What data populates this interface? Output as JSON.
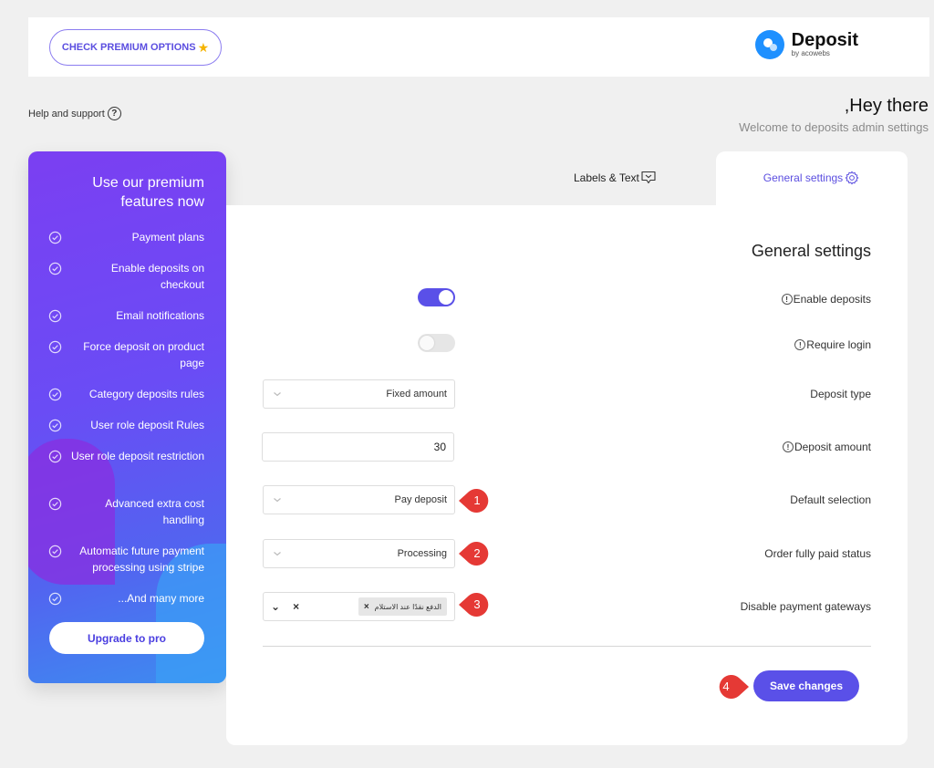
{
  "topbar": {
    "premium_label": "CHECK PREMIUM OPTIONS",
    "brand_name": "Deposit",
    "brand_sub": "by acowebs"
  },
  "help": {
    "label": "Help and support",
    "icon_glyph": "?"
  },
  "greeting": {
    "title": ",Hey there",
    "subtitle": "Welcome to deposits admin settings"
  },
  "promo": {
    "title": "Use our premium features now",
    "features": [
      "Payment plans",
      "Enable deposits on checkout",
      "Email notifications",
      "Force deposit on product page",
      "Category deposits rules",
      "User role deposit Rules",
      "User role deposit restriction",
      "Advanced extra cost handling",
      "Automatic future payment processing using stripe",
      "...And many more"
    ],
    "upgrade_label": "Upgrade to pro"
  },
  "tabs": {
    "labels_text": "Labels & Text",
    "general": "General settings"
  },
  "panel": {
    "title": "General settings",
    "info_glyph": "!",
    "enable_deposits": {
      "label": "Enable deposits",
      "enabled": true
    },
    "require_login": {
      "label": "Require login",
      "enabled": false
    },
    "deposit_type": {
      "label": "Deposit type",
      "value": "Fixed amount"
    },
    "deposit_amount": {
      "label": "Deposit amount",
      "value": "30"
    },
    "default_selection": {
      "label": "Default selection",
      "value": "Pay deposit"
    },
    "order_status": {
      "label": "Order fully paid status",
      "value": "Processing"
    },
    "disable_gateways": {
      "label": "Disable payment gateways",
      "ctrl_expand": "⌄",
      "ctrl_clear": "×",
      "tags": [
        "الدفع نقدًا عند الاستلام"
      ]
    },
    "save_label": "Save changes"
  },
  "badges": [
    "1",
    "2",
    "3",
    "4"
  ],
  "colors": {
    "accent": "#5a50e8",
    "badge": "#e53935"
  }
}
